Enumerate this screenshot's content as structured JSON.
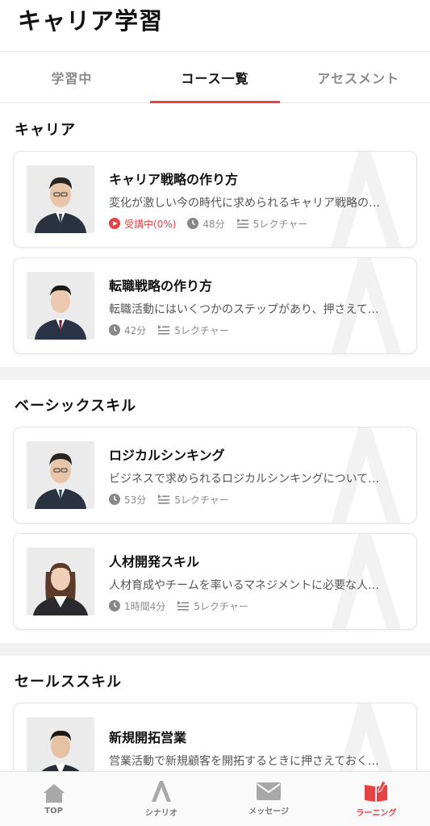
{
  "header": {
    "title": "キャリア学習"
  },
  "tabs": [
    {
      "label": "学習中",
      "active": false
    },
    {
      "label": "コース一覧",
      "active": true
    },
    {
      "label": "アセスメント",
      "active": false
    }
  ],
  "sections": [
    {
      "title": "キャリア",
      "courses": [
        {
          "title": "キャリア戦略の作り方",
          "description": "変化が激しい今の時代に求められるキャリア戦略の…",
          "progress": "受講中(0%)",
          "duration": "48分",
          "lectures": "5レクチャー"
        },
        {
          "title": "転職戦略の作り方",
          "description": "転職活動にはいくつかのステップがあり、押さえて…",
          "duration": "42分",
          "lectures": "5レクチャー"
        }
      ]
    },
    {
      "title": "ベーシックスキル",
      "courses": [
        {
          "title": "ロジカルシンキング",
          "description": "ビジネスで求められるロジカルシンキングについて…",
          "duration": "53分",
          "lectures": "5レクチャー"
        },
        {
          "title": "人材開発スキル",
          "description": "人材育成やチームを率いるマネジメントに必要な人…",
          "duration": "1時間4分",
          "lectures": "5レクチャー"
        }
      ]
    },
    {
      "title": "セールススキル",
      "courses": [
        {
          "title": "新規開拓営業",
          "description": "営業活動で新規顧客を開拓するときに押さえておく…"
        }
      ]
    }
  ],
  "bottom_nav": [
    {
      "label": "TOP",
      "icon": "home-icon"
    },
    {
      "label": "シナリオ",
      "icon": "scenario-icon"
    },
    {
      "label": "メッセージ",
      "icon": "mail-icon"
    },
    {
      "label": "ラーニング",
      "icon": "book-icon",
      "active": true
    }
  ],
  "colors": {
    "accent": "#e84141",
    "muted": "#8a8a8a"
  }
}
